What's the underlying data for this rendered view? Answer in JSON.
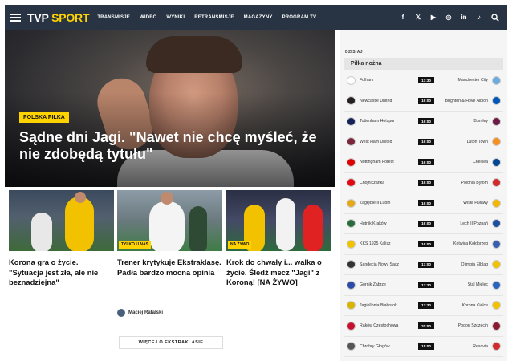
{
  "nav": {
    "logo_main": "TVP",
    "logo_accent": "SPORT",
    "menu": [
      "TRANSMISJE",
      "WIDEO",
      "WYNIKI",
      "RETRANSMISJE",
      "MAGAZYNY",
      "PROGRAM TV"
    ],
    "socials": [
      {
        "icon": "facebook-icon",
        "glyph": "f"
      },
      {
        "icon": "x-icon",
        "glyph": "𝕏"
      },
      {
        "icon": "youtube-icon",
        "glyph": "▶"
      },
      {
        "icon": "instagram-icon",
        "glyph": "◎"
      },
      {
        "icon": "linkedin-icon",
        "glyph": "in"
      },
      {
        "icon": "tiktok-icon",
        "glyph": "♪"
      }
    ],
    "colors": {
      "bar": "#283444",
      "accent": "#ffd300"
    }
  },
  "hero": {
    "badge": "POLSKA PIŁKA",
    "title": "Sądne dni Jagi. \"Nawet nie chcę myśleć, że nie zdobędą tytułu\""
  },
  "cards": [
    {
      "title": "Korona gra o życie. \"Sytuacja jest zła, ale nie beznadziejna\"",
      "badge": ""
    },
    {
      "title": "Trener krytykuje Ekstraklasę. Padła bardzo mocna opinia",
      "badge": "TYLKO U NAS",
      "author": "Maciej Rafalski"
    },
    {
      "title": "Krok do chwały i... walka o życie. Śledź mecz \"Jagi\" z Koroną! [NA ŻYWO]",
      "badge": "NA ŻYWO"
    }
  ],
  "more_button": "WIĘCEJ O EKSTRAKLASIE",
  "sidebar": {
    "today": "DZISIAJ",
    "category": "Piłka nożna",
    "matches": [
      {
        "home": "Fulham",
        "away": "Manchester City",
        "time": "13:30",
        "hc": "#ffffff",
        "ac": "#6cabdd"
      },
      {
        "home": "Newcastle United",
        "away": "Brighton & Hove Albion",
        "time": "16:00",
        "hc": "#241f20",
        "ac": "#0057b8"
      },
      {
        "home": "Tottenham Hotspur",
        "away": "Burnley",
        "time": "16:00",
        "hc": "#132257",
        "ac": "#6c1d45"
      },
      {
        "home": "West Ham United",
        "away": "Luton Town",
        "time": "16:00",
        "hc": "#7a263a",
        "ac": "#f78f1e"
      },
      {
        "home": "Nottingham Forest",
        "away": "Chelsea",
        "time": "16:00",
        "hc": "#dd0000",
        "ac": "#034694"
      },
      {
        "home": "Chojniczanka",
        "away": "Polonia Bytom",
        "time": "16:00",
        "hc": "#e30613",
        "ac": "#d12b2b"
      },
      {
        "home": "Zagłębie II Lubin",
        "away": "Wisła Puławy",
        "time": "16:00",
        "hc": "#e6a817",
        "ac": "#f2b705"
      },
      {
        "home": "Hutnik Kraków",
        "away": "Lech II Poznań",
        "time": "16:00",
        "hc": "#2b6a3c",
        "ac": "#1d4ea0"
      },
      {
        "home": "KKS 1925 Kalisz",
        "away": "Kotwica Kołobrzeg",
        "time": "16:00",
        "hc": "#f2c200",
        "ac": "#3a5fb0"
      },
      {
        "home": "Sandecja Nowy Sącz",
        "away": "Olimpia Elbląg",
        "time": "17:00",
        "hc": "#333333",
        "ac": "#f2c200"
      },
      {
        "home": "Górnik Zabrze",
        "away": "Stal Mielec",
        "time": "17:30",
        "hc": "#2e4aa8",
        "ac": "#2a62c0"
      },
      {
        "home": "Jagiellonia Białystok",
        "away": "Korona Kielce",
        "time": "17:30",
        "hc": "#d8b400",
        "ac": "#f2c200"
      },
      {
        "home": "Raków Częstochowa",
        "away": "Pogoń Szczecin",
        "time": "20:00",
        "hc": "#c8102e",
        "ac": "#8a1a2f"
      },
      {
        "home": "Chrobry Głogów",
        "away": "Resovia",
        "time": "15:00",
        "hc": "#555555",
        "ac": "#d12b2b"
      }
    ]
  }
}
